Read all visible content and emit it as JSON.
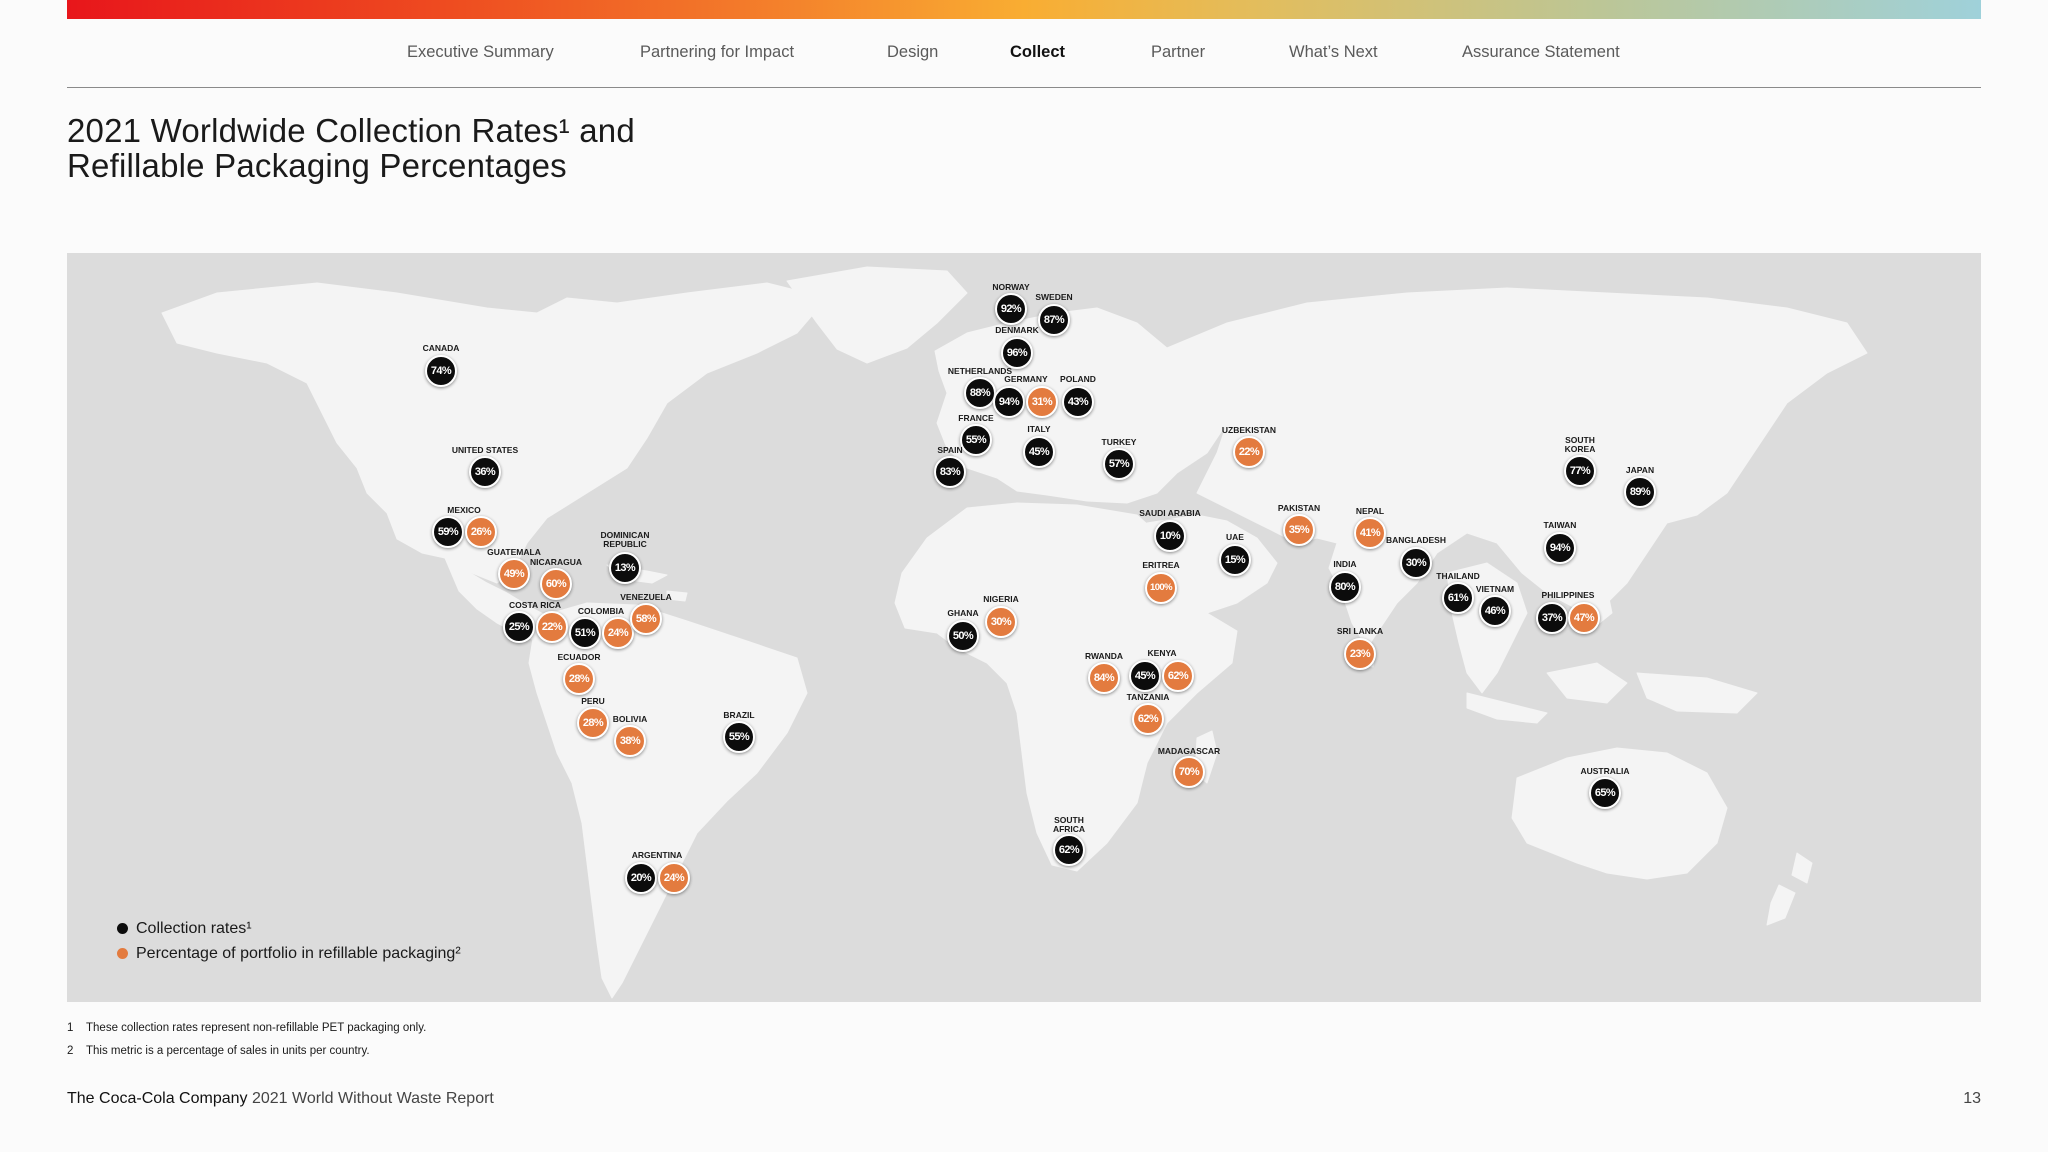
{
  "nav": {
    "items": [
      {
        "label": "Executive Summary",
        "active": false
      },
      {
        "label": "Partnering for Impact",
        "active": false
      },
      {
        "label": "Design",
        "active": false
      },
      {
        "label": "Collect",
        "active": true
      },
      {
        "label": "Partner",
        "active": false
      },
      {
        "label": "What’s Next",
        "active": false
      },
      {
        "label": "Assurance Statement",
        "active": false
      }
    ]
  },
  "title": {
    "line1": "2021 Worldwide Collection Rates¹ and",
    "line2": "Refillable Packaging Percentages"
  },
  "colors": {
    "collection": "#0c0c0c",
    "refillable": "#e37b3f",
    "land": "#f4f4f4",
    "ocean": "#dcdcdc"
  },
  "legend": {
    "collection_label": "Collection rates¹",
    "refillable_label": "Percentage of portfolio in refillable packaging²"
  },
  "countries": [
    {
      "name": "NORWAY",
      "collection": "92%"
    },
    {
      "name": "SWEDEN",
      "collection": "87%"
    },
    {
      "name": "DENMARK",
      "collection": "96%"
    },
    {
      "name": "NETHERLANDS",
      "collection": "88%"
    },
    {
      "name": "GERMANY",
      "collection": "94%",
      "refillable": "31%"
    },
    {
      "name": "POLAND",
      "collection": "43%"
    },
    {
      "name": "FRANCE",
      "collection": "55%"
    },
    {
      "name": "ITALY",
      "collection": "45%"
    },
    {
      "name": "SPAIN",
      "collection": "83%"
    },
    {
      "name": "TURKEY",
      "collection": "57%"
    },
    {
      "name": "UZBEKISTAN",
      "refillable": "22%"
    },
    {
      "name": "CANADA",
      "collection": "74%"
    },
    {
      "name": "UNITED STATES",
      "collection": "36%"
    },
    {
      "name": "MEXICO",
      "collection": "59%",
      "refillable": "26%"
    },
    {
      "name": "GUATEMALA",
      "refillable": "49%"
    },
    {
      "name": "NICARAGUA",
      "refillable": "60%"
    },
    {
      "name": "DOMINICAN REPUBLIC",
      "collection": "13%"
    },
    {
      "name": "COSTA RICA",
      "collection": "25%",
      "refillable": "22%"
    },
    {
      "name": "COLOMBIA",
      "collection": "51%",
      "refillable": "24%"
    },
    {
      "name": "VENEZUELA",
      "refillable": "58%"
    },
    {
      "name": "ECUADOR",
      "refillable": "28%"
    },
    {
      "name": "PERU",
      "refillable": "28%"
    },
    {
      "name": "BOLIVIA",
      "refillable": "38%"
    },
    {
      "name": "BRAZIL",
      "collection": "55%"
    },
    {
      "name": "ARGENTINA",
      "collection": "20%",
      "refillable": "24%"
    },
    {
      "name": "SAUDI ARABIA",
      "collection": "10%"
    },
    {
      "name": "UAE",
      "collection": "15%"
    },
    {
      "name": "ERITREA",
      "refillable": "100%"
    },
    {
      "name": "NIGERIA",
      "refillable": "30%"
    },
    {
      "name": "GHANA",
      "collection": "50%"
    },
    {
      "name": "RWANDA",
      "refillable": "84%"
    },
    {
      "name": "KENYA",
      "collection": "45%",
      "refillable": "62%"
    },
    {
      "name": "TANZANIA",
      "refillable": "62%"
    },
    {
      "name": "MADAGASCAR",
      "refillable": "70%"
    },
    {
      "name": "SOUTH AFRICA",
      "collection": "62%"
    },
    {
      "name": "PAKISTAN",
      "refillable": "35%"
    },
    {
      "name": "NEPAL",
      "refillable": "41%"
    },
    {
      "name": "INDIA",
      "collection": "80%"
    },
    {
      "name": "BANGLADESH",
      "collection": "30%"
    },
    {
      "name": "SRI LANKA",
      "refillable": "23%"
    },
    {
      "name": "THAILAND",
      "collection": "61%"
    },
    {
      "name": "VIETNAM",
      "collection": "46%"
    },
    {
      "name": "PHILIPPINES",
      "collection": "37%",
      "refillable": "47%"
    },
    {
      "name": "TAIWAN",
      "collection": "94%"
    },
    {
      "name": "SOUTH KOREA",
      "collection": "77%"
    },
    {
      "name": "JAPAN",
      "collection": "89%"
    },
    {
      "name": "AUSTRALIA",
      "collection": "65%"
    }
  ],
  "footnotes": [
    {
      "num": "1",
      "text": "These collection rates represent non-refillable PET packaging only."
    },
    {
      "num": "2",
      "text": "This metric is a percentage of sales in units per country."
    }
  ],
  "footer": {
    "brand": "The Coca-Cola Company",
    "report": "2021 World Without Waste Report",
    "page": "13"
  }
}
